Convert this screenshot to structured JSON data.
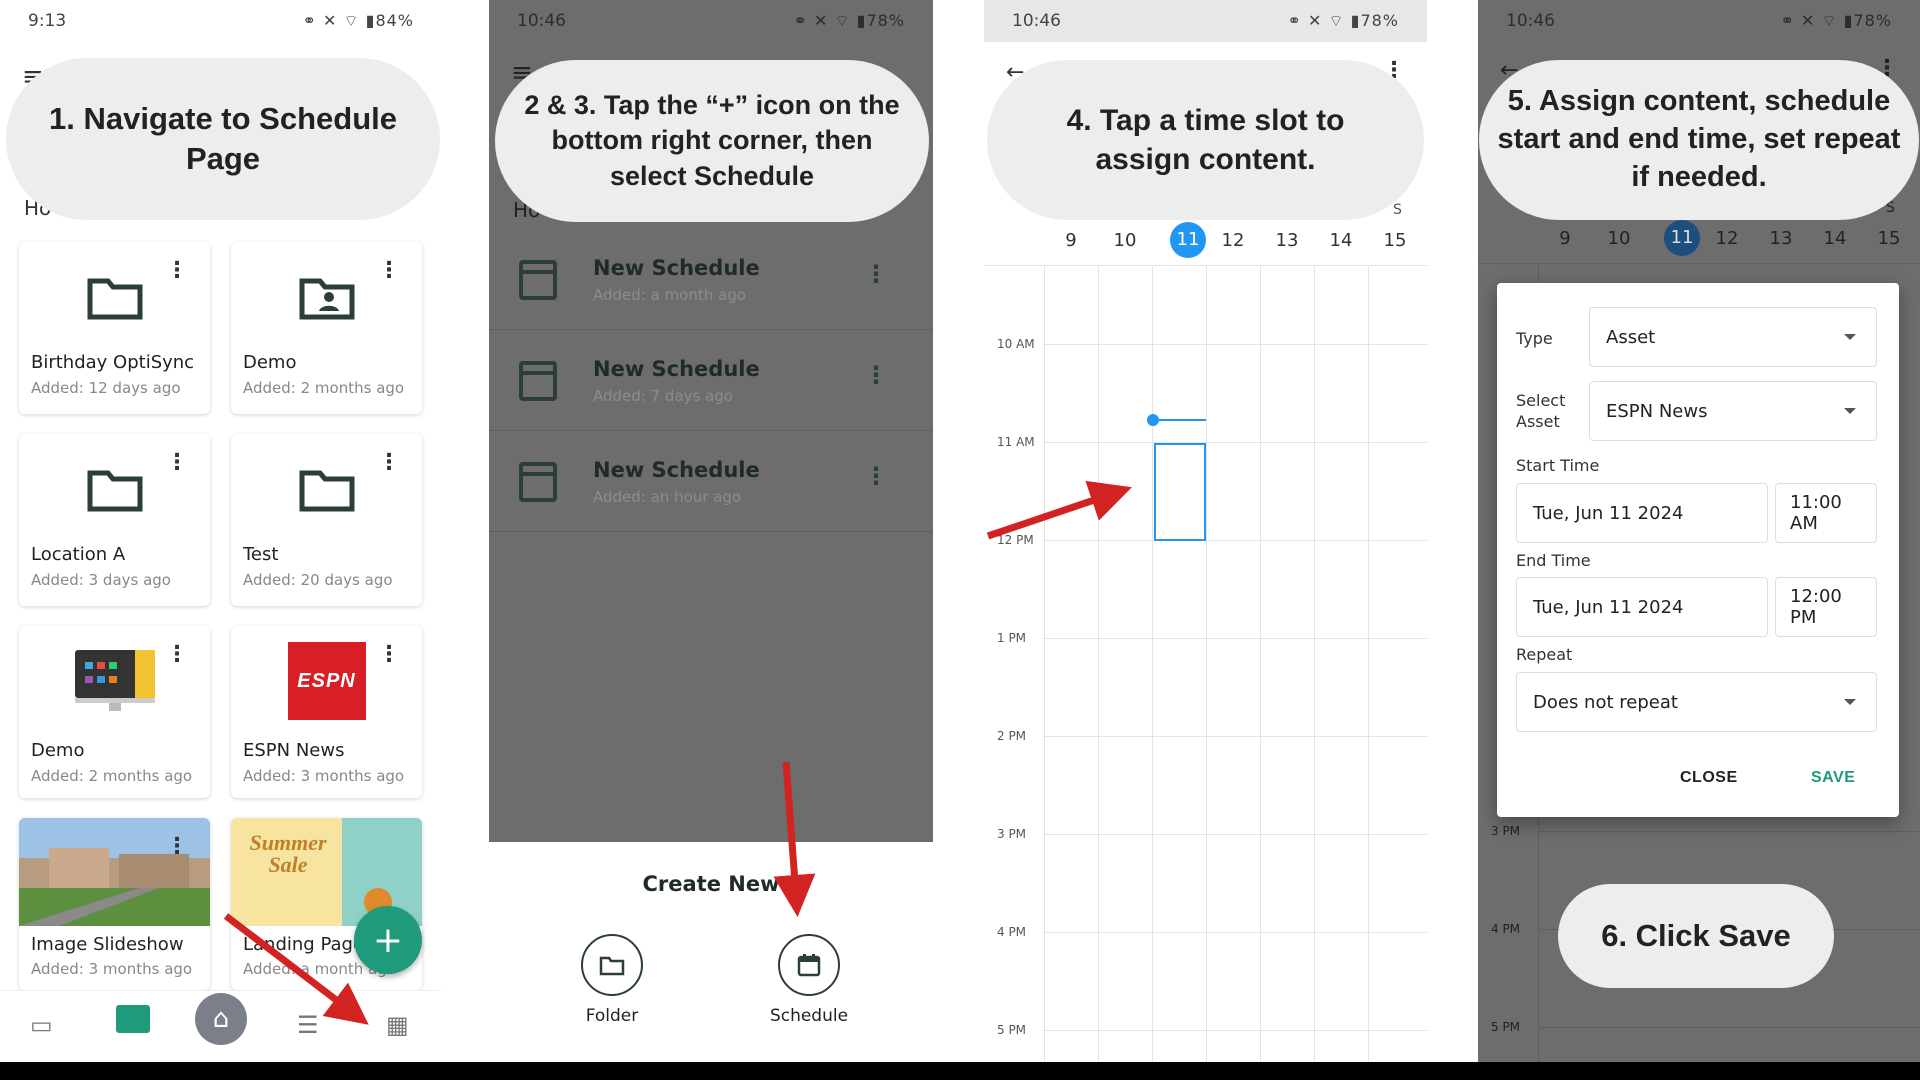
{
  "panel1": {
    "status_time": "9:13",
    "status_right": "84%",
    "callout": "1. Navigate to Schedule Page",
    "partial_header": "Ho",
    "cards": [
      {
        "name": "Birthday OptiSync ...",
        "added": "Added: 12 days ago",
        "icon": "folder-icon"
      },
      {
        "name": "Demo",
        "added": "Added: 2 months ago",
        "icon": "shared-folder-icon"
      },
      {
        "name": "Location A",
        "added": "Added: 3 days ago",
        "icon": "folder-icon"
      },
      {
        "name": "Test",
        "added": "Added: 20 days ago",
        "icon": "folder-icon"
      },
      {
        "name": "Demo",
        "added": "Added: 2 months ago",
        "icon": "monitor-thumbnail"
      },
      {
        "name": "ESPN News",
        "added": "Added: 3 months ago",
        "icon": "espn-logo"
      },
      {
        "name": "Image Slideshow",
        "added": "Added: 3 months ago",
        "icon": "photo-thumbnail"
      },
      {
        "name": "Landing Page",
        "added": "Added: a month ago",
        "icon": "summer-sale-thumbnail"
      }
    ],
    "espn_logo_text": "ESPN",
    "summer_sale_text": "Summer Sale",
    "fab_label": "+",
    "accent": "#1f9b7c"
  },
  "panel2": {
    "status_time": "10:46",
    "status_right": "78%",
    "callout": "2 & 3. Tap the “+” icon on the bottom right corner, then select Schedule",
    "partial_header": "Ho",
    "schedules": [
      {
        "title": "New Schedule",
        "added": "Added: a month ago"
      },
      {
        "title": "New Schedule",
        "added": "Added: 7 days ago"
      },
      {
        "title": "New Schedule",
        "added": "Added: an hour ago"
      }
    ],
    "sheet_title": "Create New",
    "folder_label": "Folder",
    "schedule_label": "Schedule"
  },
  "panel3": {
    "status_time": "10:46",
    "status_right": "78%",
    "callout": "4. Tap a time slot to assign content.",
    "weekday_letter": "S",
    "days": [
      "9",
      "10",
      "11",
      "12",
      "13",
      "14",
      "15"
    ],
    "selected_day": "11",
    "hours": [
      "10 AM",
      "11 AM",
      "12 PM",
      "1 PM",
      "2 PM",
      "3 PM",
      "4 PM",
      "5 PM"
    ],
    "selected_color": "#2196f3"
  },
  "panel4": {
    "status_time": "10:46",
    "status_right": "78%",
    "callout": "5. Assign content, schedule start and end time, set repeat if needed.",
    "weekday_letter": "S",
    "days": [
      "9",
      "10",
      "11",
      "12",
      "13",
      "14",
      "15"
    ],
    "hours_visible": [
      "3 PM",
      "4 PM",
      "5 PM"
    ],
    "dialog": {
      "type_label": "Type",
      "type_value": "Asset",
      "select_asset_label": "Select Asset",
      "select_asset_value": "ESPN News",
      "start_time_label": "Start Time",
      "start_date": "Tue, Jun 11 2024",
      "start_time": "11:00 AM",
      "end_time_label": "End Time",
      "end_date": "Tue, Jun 11 2024",
      "end_time": "12:00 PM",
      "repeat_label": "Repeat",
      "repeat_value": "Does not repeat",
      "close_label": "CLOSE",
      "save_label": "SAVE"
    },
    "callout_save": "6. Click Save"
  }
}
